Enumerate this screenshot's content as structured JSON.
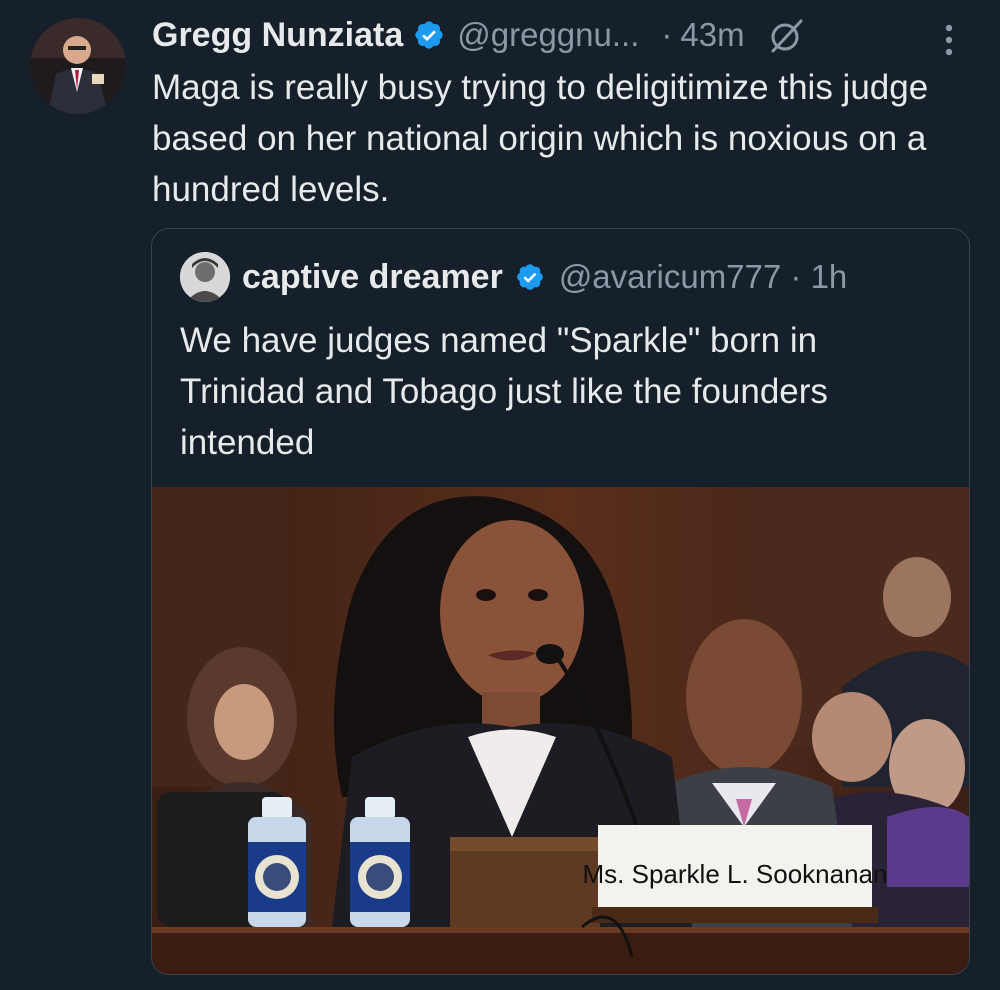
{
  "tweet": {
    "author_name": "Gregg Nunziata",
    "handle": "@greggnu...",
    "separator": "·",
    "time": "43m",
    "text": "Maga is really busy trying to deligitimize this judge based on her national origin which is noxious on a hundred levels."
  },
  "quoted_tweet": {
    "author_name": "captive dreamer",
    "handle_time": "@avaricum777 · 1h",
    "text": "We have judges named \"Sparkle\" born in Trinidad and Tobago just like the founders intended",
    "image": {
      "nameplate_text": "Ms. Sparkle L. Sooknanan"
    }
  },
  "icons": {
    "verified": "verified-badge-icon",
    "grok": "grok-icon",
    "more": "more-options-icon"
  },
  "colors": {
    "background": "#15202b",
    "text_primary": "#e7e9ea",
    "text_secondary": "#8b98a5",
    "verified_blue": "#1d9bf0",
    "border": "#38444d"
  }
}
